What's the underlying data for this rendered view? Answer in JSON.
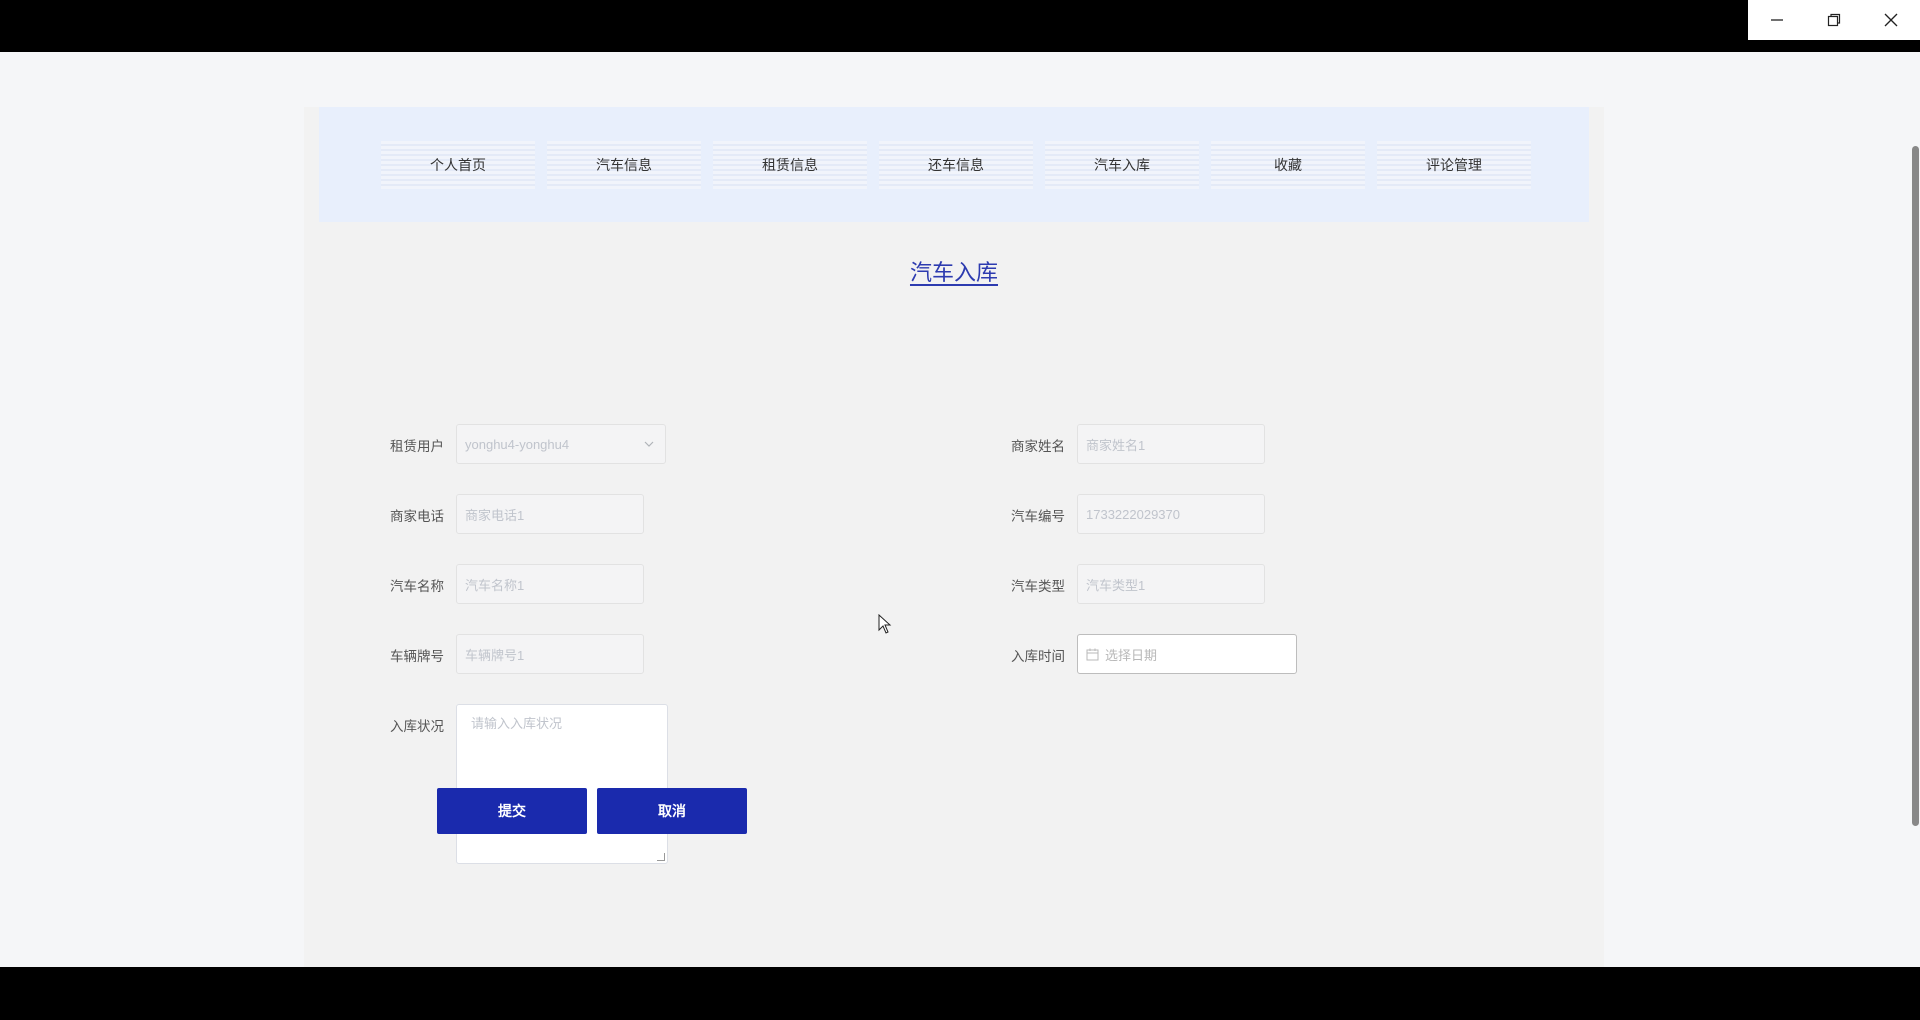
{
  "nav": {
    "items": [
      "个人首页",
      "汽车信息",
      "租赁信息",
      "还车信息",
      "汽车入库",
      "收藏",
      "评论管理"
    ]
  },
  "form": {
    "title": "汽车入库",
    "fields": {
      "rent_user": {
        "label": "租赁用户",
        "value": "yonghu4-yonghu4"
      },
      "merchant_name": {
        "label": "商家姓名",
        "placeholder": "商家姓名1"
      },
      "merchant_phone": {
        "label": "商家电话",
        "placeholder": "商家电话1"
      },
      "car_number": {
        "label": "汽车编号",
        "placeholder": "1733222029370"
      },
      "car_name": {
        "label": "汽车名称",
        "placeholder": "汽车名称1"
      },
      "car_type": {
        "label": "汽车类型",
        "placeholder": "汽车类型1"
      },
      "plate_number": {
        "label": "车辆牌号",
        "placeholder": "车辆牌号1"
      },
      "storage_time": {
        "label": "入库时间",
        "placeholder": "选择日期"
      },
      "storage_status": {
        "label": "入库状况",
        "placeholder": "请输入入库状况"
      }
    },
    "submit_label": "提交",
    "cancel_label": "取消"
  },
  "colors": {
    "primary_button": "#1a2aad",
    "title": "#2d3bb0",
    "nav_bg": "#e8effc"
  }
}
